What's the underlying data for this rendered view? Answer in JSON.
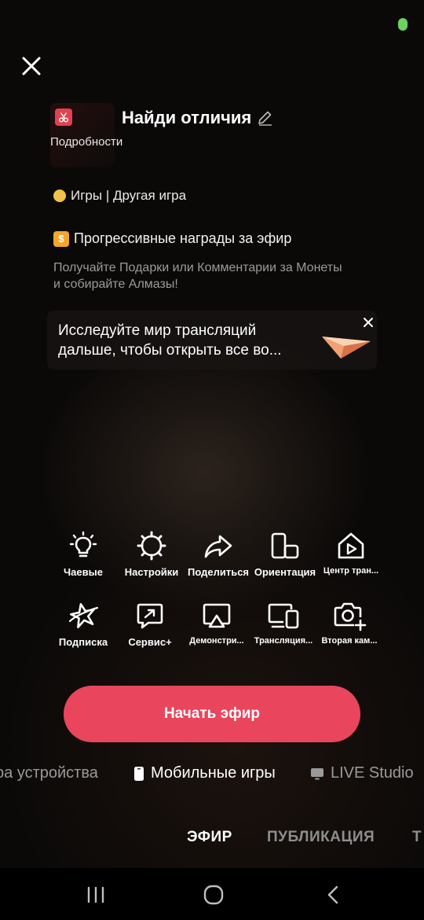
{
  "stream": {
    "cover_label": "Подробности",
    "title": "Найди отличия",
    "topic": "Игры | Другая игра"
  },
  "rewards": {
    "title": "Прогрессивные награды за эфир",
    "description": "Получайте Подарки или Комментарии за Монеты и собирайте Алмазы!"
  },
  "tip": {
    "line1": "Исследуйте мир трансляций",
    "line2": "дальше, чтобы открыть все во..."
  },
  "tools_row1": [
    {
      "label": "Чаевые",
      "icon": "lightbulb-icon"
    },
    {
      "label": "Настройки",
      "icon": "gear-icon"
    },
    {
      "label": "Поделиться",
      "icon": "share-arrow-icon"
    },
    {
      "label": "Ориентация",
      "icon": "orientation-icon"
    },
    {
      "label": "Центр тран...",
      "icon": "live-center-icon"
    }
  ],
  "tools_row2": [
    {
      "label": "Подписка",
      "icon": "subscription-star-icon"
    },
    {
      "label": "Сервис+",
      "icon": "service-plus-icon"
    },
    {
      "label": "Демонстри...",
      "icon": "screen-cast-icon"
    },
    {
      "label": "Трансляция...",
      "icon": "multi-device-icon"
    },
    {
      "label": "Вторая кам...",
      "icon": "add-camera-icon"
    }
  ],
  "start_button": "Начать эфир",
  "modes": [
    {
      "label": "ра устройства",
      "icon": ""
    },
    {
      "label": "Мобильные игры",
      "icon": "phone-icon"
    },
    {
      "label": "LIVE Studio",
      "icon": "monitor-icon"
    }
  ],
  "tabs": [
    "ЭФИР",
    "ПУБЛИКАЦИЯ",
    "Т"
  ],
  "colors": {
    "accent": "#e9455c",
    "status_dot": "#6ad25f",
    "coin": "#f2c14a",
    "reward_icon": "#f3a52c"
  }
}
